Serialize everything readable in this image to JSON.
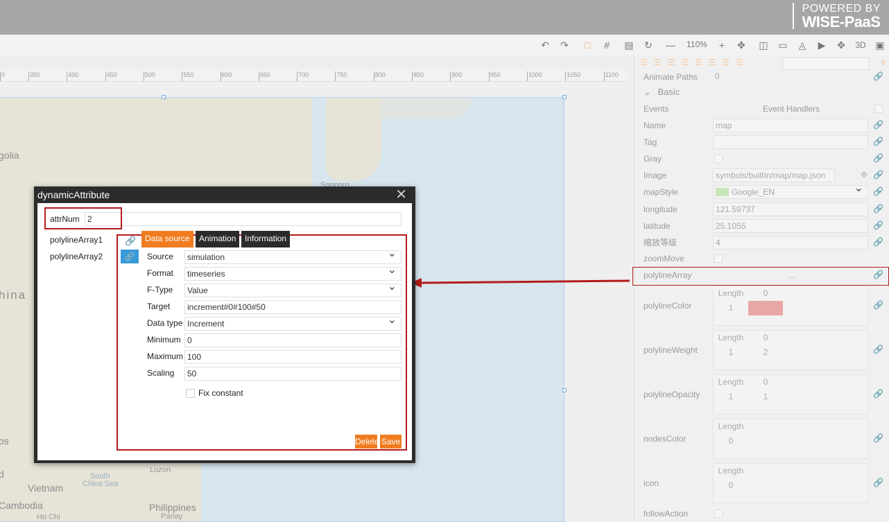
{
  "header": {
    "brand_line1": "POWERED BY",
    "brand_line2": "WISE-PaaS"
  },
  "toolbar": {
    "zoom": "110%",
    "mode3d": "3D",
    "icons": [
      "undo-icon",
      "redo-icon",
      "select-icon",
      "grid-icon",
      "save-icon",
      "refresh-icon",
      "zoom-out-icon",
      "zoom-in-icon",
      "fit-icon",
      "panel-left-icon",
      "panel-center-icon",
      "panel-right-icon",
      "play-icon",
      "move-icon",
      "3d-icon",
      "export-icon"
    ]
  },
  "ruler": {
    "ticks": [
      "0",
      "350",
      "400",
      "450",
      "500",
      "550",
      "600",
      "650",
      "700",
      "750",
      "800",
      "850",
      "900",
      "950",
      "1000",
      "1050",
      "1100"
    ]
  },
  "map": {
    "labels": {
      "mongolia": "golia",
      "china": "hina",
      "sapporo": "Sapporo",
      "vietnam": "Vietnam",
      "cambodia": "Cambodia",
      "south_china_sea_1": "South",
      "south_china_sea_2": "China Sea",
      "luzon": "Luzon",
      "philippines": "Philippines",
      "panay": "Panay",
      "hochi": "Ho Chi",
      "os": "os",
      "d": "d"
    }
  },
  "properties": {
    "animate_paths_label": "Animate Paths",
    "animate_paths_value": "0",
    "section_basic": "Basic",
    "events_label": "Events",
    "event_handlers": "Event Handlers",
    "name_label": "Name",
    "name_value": "map",
    "tag_label": "Tag",
    "tag_value": "",
    "gray_label": "Gray",
    "image_label": "Image",
    "image_value": "symbols/builtIn/map/map.json",
    "mapstyle_label": "mapStyle",
    "mapstyle_value": "Google_EN",
    "mapstyle_color": "#c7e8b6",
    "longitude_label": "longitude",
    "longitude_value": "121.59737",
    "latitude_label": "latitude",
    "latitude_value": "25.1055",
    "zoom_level_label": "缩放等级",
    "zoom_level_value": "4",
    "zoommove_label": "zoomMove",
    "polylinearray_label": "polylineArray",
    "polylinearray_value": "...",
    "polylinecolor_label": "polylineColor",
    "polylinecolor_color": "#e8a7a7",
    "polylineweight_label": "polylineWeight",
    "polylineopacity_label": "polylineOpacity",
    "nodescolor_label": "nodesColor",
    "icon_label": "icon",
    "followaction_label": "followAction",
    "length_label": "Length",
    "grid_zero": "0",
    "grid_one": "1",
    "grid_two": "2"
  },
  "dialog": {
    "title": "dynamicAttribute",
    "attrnum_label": "attrNum",
    "attrnum_value": "2",
    "array_items": [
      "polylineArray1",
      "polylineArray2"
    ],
    "tabs": [
      "Data source",
      "Animation",
      "Information"
    ],
    "source_label": "Source",
    "source_value": "simulation",
    "format_label": "Format",
    "format_value": "timeseries",
    "ftype_label": "F-Type",
    "ftype_value": "Value",
    "target_label": "Target",
    "target_value": "increment#0#100#50",
    "datatype_label": "Data type",
    "datatype_value": "Increment",
    "minimum_label": "Minimum",
    "minimum_value": "0",
    "maximum_label": "Maximum",
    "maximum_value": "100",
    "scaling_label": "Scaling",
    "scaling_value": "50",
    "fix_constant_label": "Fix constant",
    "delete_label": "Delete",
    "save_label": "Save"
  }
}
